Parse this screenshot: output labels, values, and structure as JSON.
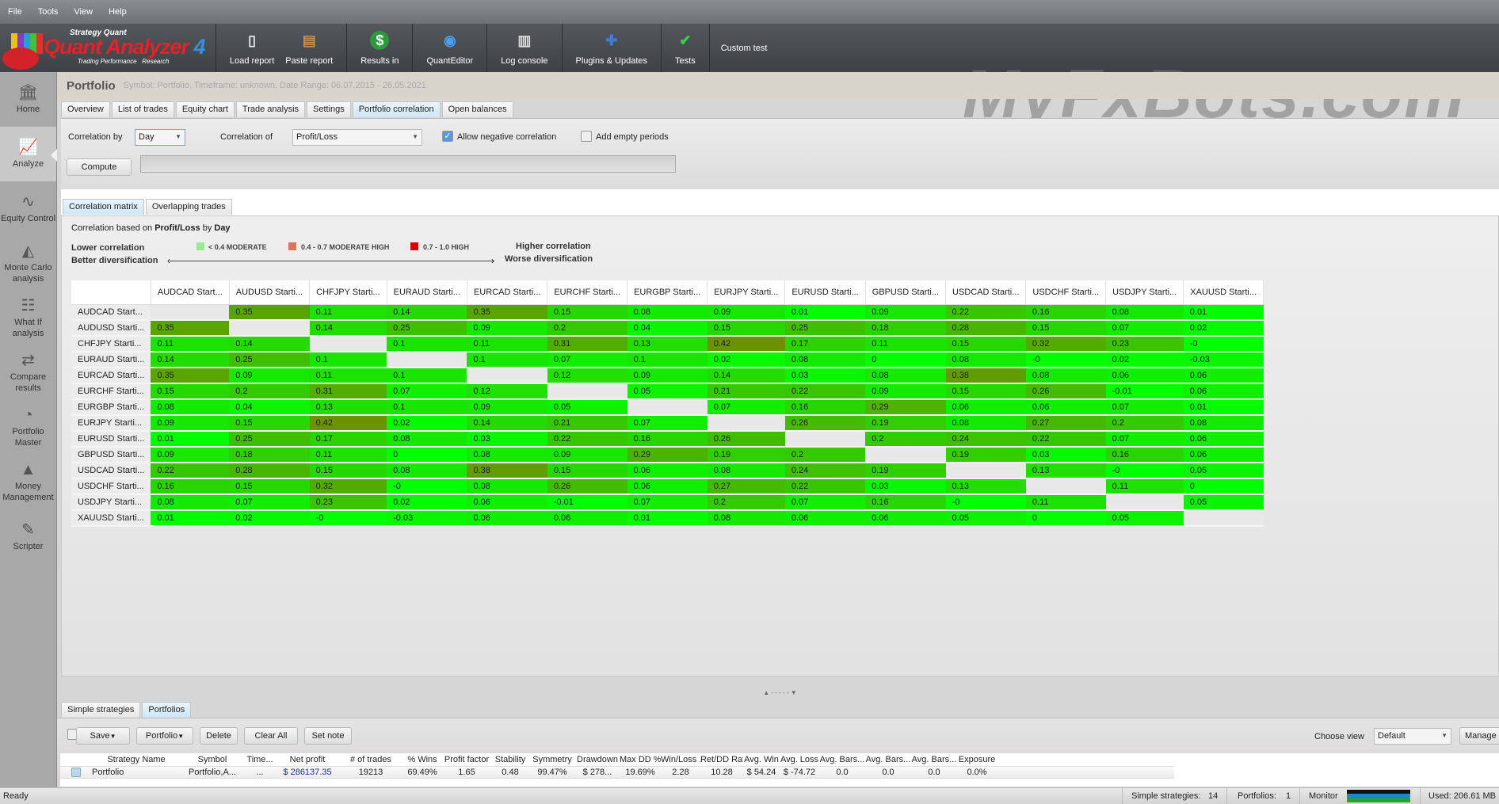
{
  "menu": [
    "File",
    "Tools",
    "View",
    "Help"
  ],
  "logo": {
    "top": "Strategy Quant",
    "name": "Quant Analyzer",
    "version": "4",
    "tagline": "Trading Performance   Research"
  },
  "toolbar": {
    "groups": [
      [
        {
          "label": "Load report",
          "icon": "document-icon"
        },
        {
          "label": "Paste report",
          "icon": "clipboard-icon"
        }
      ],
      [
        {
          "label": "Results in",
          "icon": "dollar-icon"
        }
      ],
      [
        {
          "label": "QuantEditor",
          "icon": "editor-icon"
        }
      ],
      [
        {
          "label": "Log console",
          "icon": "book-icon"
        }
      ],
      [
        {
          "label": "Plugins & Updates",
          "icon": "puzzle-icon"
        }
      ],
      [
        {
          "label": "Tests",
          "icon": "check-icon"
        }
      ]
    ],
    "custom_test": "Custom test"
  },
  "watermark": "MyFxBots.com",
  "sidebar": [
    {
      "label": "Home",
      "icon": "bank-icon"
    },
    {
      "label": "Analyze",
      "icon": "chart-bars-icon",
      "active": true
    },
    {
      "label": "Equity Control",
      "icon": "line-nodes-icon"
    },
    {
      "label": "Monte Carlo analysis",
      "icon": "area-chart-icon"
    },
    {
      "label": "What If analysis",
      "icon": "hierarchy-icon"
    },
    {
      "label": "Compare results",
      "icon": "arrows-icon"
    },
    {
      "label": "Portfolio Master",
      "icon": "pie-icon"
    },
    {
      "label": "Money Management",
      "icon": "mountain-chart-icon"
    },
    {
      "label": "Scripter",
      "icon": "pencil-icon"
    }
  ],
  "page": {
    "title": "Portfolio",
    "subtitle": "Symbol: Portfolio, Timeframe: unknown, Date Range: 06.07.2015 - 26.05.2021"
  },
  "tabs": [
    {
      "label": "Overview"
    },
    {
      "label": "List of trades"
    },
    {
      "label": "Equity chart"
    },
    {
      "label": "Trade analysis"
    },
    {
      "label": "Settings"
    },
    {
      "label": "Portfolio correlation",
      "active": true
    },
    {
      "label": "Open balances"
    }
  ],
  "controls": {
    "correlation_by_label": "Correlation by",
    "correlation_by": "Day",
    "correlation_of_label": "Correlation of",
    "correlation_of": "Profit/Loss",
    "allow_negative": "Allow negative correlation",
    "allow_negative_checked": true,
    "add_empty": "Add empty periods",
    "add_empty_checked": false,
    "compute": "Compute",
    "progress": 0
  },
  "subtabs": [
    {
      "label": "Correlation matrix",
      "active": true
    },
    {
      "label": "Overlapping trades"
    }
  ],
  "basis": {
    "prefix": "Correlation based on ",
    "metric": "Profit/Loss",
    "by": " by ",
    "period": "Day"
  },
  "legend": {
    "lower1": "Lower correlation",
    "lower2": "Better diversification",
    "higher1": "Higher correlation",
    "higher2": "Worse diversification",
    "items": [
      {
        "label": "< 0.4 MODERATE",
        "color": "#90ee90"
      },
      {
        "label": "0.4 - 0.7 MODERATE HIGH",
        "color": "#e07060"
      },
      {
        "label": "0.7 - 1.0 HIGH",
        "color": "#e00000"
      }
    ]
  },
  "matrix": {
    "columns": [
      "AUDCAD Start...",
      "AUDUSD Starti...",
      "CHFJPY Starti...",
      "EURAUD Starti...",
      "EURCAD Starti...",
      "EURCHF Starti...",
      "EURGBP Starti...",
      "EURJPY Starti...",
      "EURUSD Starti...",
      "GBPUSD Starti...",
      "USDCAD Starti...",
      "USDCHF Starti...",
      "USDJPY Starti...",
      "XAUUSD Starti..."
    ],
    "rows": [
      {
        "label": "AUDCAD Start...",
        "values": [
          null,
          "0.35",
          "0.11",
          "0.14",
          "0.35",
          "0.15",
          "0.08",
          "0.09",
          "0.01",
          "0.09",
          "0.22",
          "0.16",
          "0.08",
          "0.01"
        ]
      },
      {
        "label": "AUDUSD Starti...",
        "values": [
          "0.35",
          null,
          "0.14",
          "0.25",
          "0.09",
          "0.2",
          "0.04",
          "0.15",
          "0.25",
          "0.18",
          "0.28",
          "0.15",
          "0.07",
          "0.02"
        ]
      },
      {
        "label": "CHFJPY Starti...",
        "values": [
          "0.11",
          "0.14",
          null,
          "0.1",
          "0.11",
          "0.31",
          "0.13",
          "0.42",
          "0.17",
          "0.11",
          "0.15",
          "0.32",
          "0.23",
          "-0"
        ]
      },
      {
        "label": "EURAUD Starti...",
        "values": [
          "0.14",
          "0.25",
          "0.1",
          null,
          "0.1",
          "0.07",
          "0.1",
          "0.02",
          "0.08",
          "0",
          "0.08",
          "-0",
          "0.02",
          "-0.03"
        ]
      },
      {
        "label": "EURCAD Starti...",
        "values": [
          "0.35",
          "0.09",
          "0.11",
          "0.1",
          null,
          "0.12",
          "0.09",
          "0.14",
          "0.03",
          "0.08",
          "0.38",
          "0.08",
          "0.06",
          "0.06"
        ]
      },
      {
        "label": "EURCHF Starti...",
        "values": [
          "0.15",
          "0.2",
          "0.31",
          "0.07",
          "0.12",
          null,
          "0.05",
          "0.21",
          "0.22",
          "0.09",
          "0.15",
          "0.26",
          "-0.01",
          "0.06"
        ]
      },
      {
        "label": "EURGBP Starti...",
        "values": [
          "0.08",
          "0.04",
          "0.13",
          "0.1",
          "0.09",
          "0.05",
          null,
          "0.07",
          "0.16",
          "0.29",
          "0.06",
          "0.06",
          "0.07",
          "0.01"
        ]
      },
      {
        "label": "EURJPY Starti...",
        "values": [
          "0.09",
          "0.15",
          "0.42",
          "0.02",
          "0.14",
          "0.21",
          "0.07",
          null,
          "0.26",
          "0.19",
          "0.08",
          "0.27",
          "0.2",
          "0.08"
        ]
      },
      {
        "label": "EURUSD Starti...",
        "values": [
          "0.01",
          "0.25",
          "0.17",
          "0.08",
          "0.03",
          "0.22",
          "0.16",
          "0.26",
          null,
          "0.2",
          "0.24",
          "0.22",
          "0.07",
          "0.06"
        ]
      },
      {
        "label": "GBPUSD Starti...",
        "values": [
          "0.09",
          "0.18",
          "0.11",
          "0",
          "0.08",
          "0.09",
          "0.29",
          "0.19",
          "0.2",
          null,
          "0.19",
          "0.03",
          "0.16",
          "0.06"
        ]
      },
      {
        "label": "USDCAD Starti...",
        "values": [
          "0.22",
          "0.28",
          "0.15",
          "0.08",
          "0.38",
          "0.15",
          "0.06",
          "0.08",
          "0.24",
          "0.19",
          null,
          "0.13",
          "-0",
          "0.05"
        ]
      },
      {
        "label": "USDCHF Starti...",
        "values": [
          "0.16",
          "0.15",
          "0.32",
          "-0",
          "0.08",
          "0.26",
          "0.06",
          "0.27",
          "0.22",
          "0.03",
          "0.13",
          null,
          "0.11",
          "0"
        ]
      },
      {
        "label": "USDJPY Starti...",
        "values": [
          "0.08",
          "0.07",
          "0.23",
          "0.02",
          "0.06",
          "-0.01",
          "0.07",
          "0.2",
          "0.07",
          "0.16",
          "-0",
          "0.11",
          null,
          "0.05"
        ]
      },
      {
        "label": "XAUUSD Starti...",
        "values": [
          "0.01",
          "0.02",
          "-0",
          "-0.03",
          "0.06",
          "0.06",
          "0.01",
          "0.08",
          "0.06",
          "0.06",
          "0.05",
          "0",
          "0.05",
          null
        ]
      }
    ]
  },
  "bottom": {
    "tabs": [
      {
        "label": "Simple strategies"
      },
      {
        "label": "Portfolios",
        "active": true
      }
    ],
    "buttons": [
      "Save",
      "Portfolio",
      "Delete",
      "Clear All",
      "Set note"
    ],
    "choose_view_label": "Choose view",
    "choose_view": "Default",
    "manage": "Manage",
    "columns": [
      "Strategy Name",
      "Symbol",
      "Time...",
      "Net profit",
      "# of trades",
      "% Wins",
      "Profit factor",
      "Stability",
      "Symmetry",
      "Drawdown",
      "Max DD %",
      "Win/Loss ...",
      "Ret/DD Ratio",
      "Avg. Win",
      "Avg. Loss",
      "Avg. Bars...",
      "Avg. Bars...",
      "Avg. Bars...",
      "Exposure"
    ],
    "row": [
      "Portfolio",
      "Portfolio,A...",
      "...",
      "$ 286137.35",
      "19213",
      "69.49%",
      "1.65",
      "0.48",
      "99.47%",
      "$ 278...",
      "19.69%",
      "2.28",
      "10.28",
      "$ 54.24",
      "$ -74.72",
      "0.0",
      "0.0",
      "0.0",
      "0.0%"
    ]
  },
  "status": {
    "ready": "Ready",
    "simple_label": "Simple strategies:",
    "simple_count": "14",
    "portfolios_label": "Portfolios:",
    "portfolios_count": "1",
    "monitor": "Monitor",
    "used": "Used: 206.61 MB"
  }
}
